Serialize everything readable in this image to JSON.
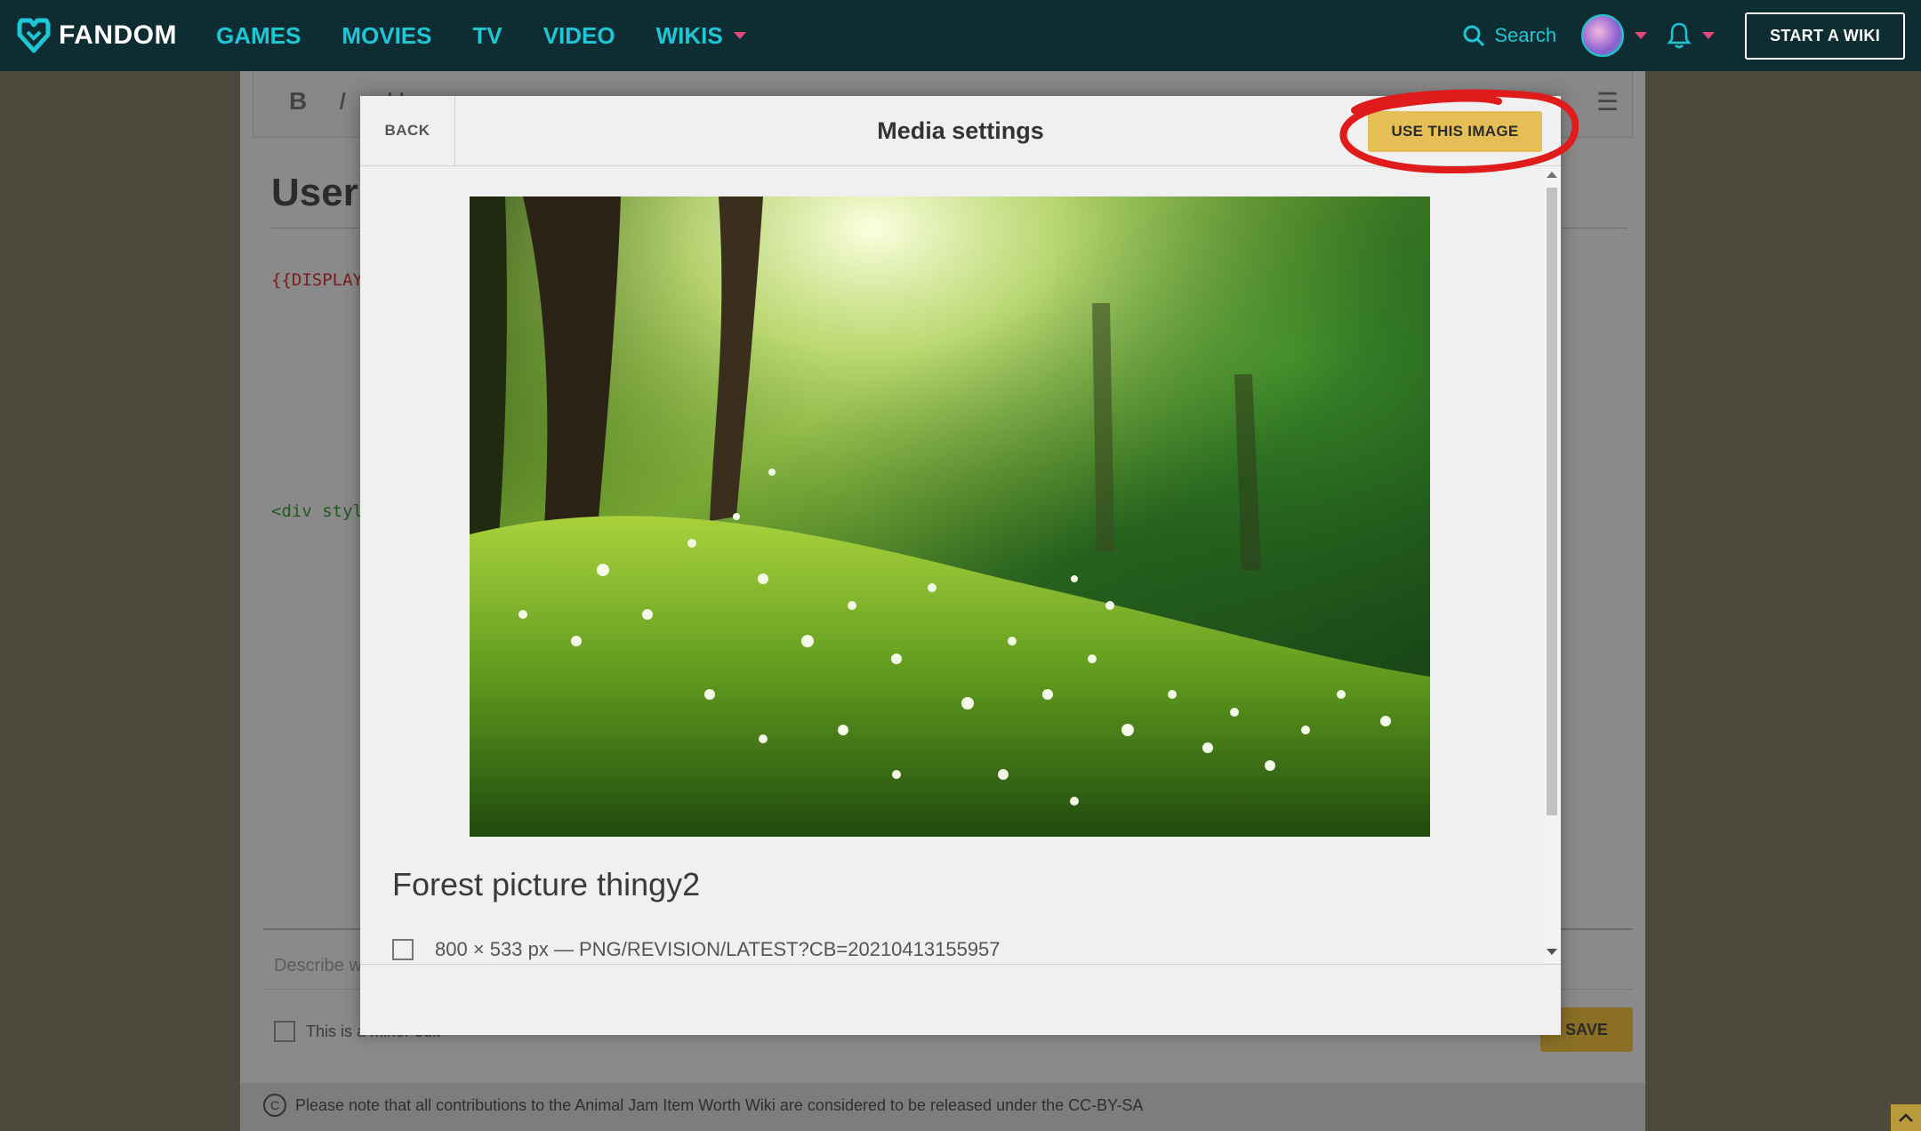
{
  "nav": {
    "brand": "FANDOM",
    "links": [
      "GAMES",
      "MOVIES",
      "TV",
      "VIDEO",
      "WIKIS"
    ],
    "search_label": "Search",
    "start_wiki": "START A WIKI",
    "accent": "#1ec7d6",
    "background": "#0d2d33"
  },
  "editor": {
    "toolbar_mode": "ADVANCED",
    "page_title": "User",
    "code_line_1": "{{DISPLAY",
    "code_line_2": "<div styl",
    "summary_placeholder": "Describe w",
    "minor_edit_label": "This is a minor edit",
    "save_label": "SAVE",
    "license_note": "Please note that all contributions to the Animal Jam Item Worth Wiki are considered to be released under the CC-BY-SA"
  },
  "modal": {
    "back_label": "BACK",
    "title": "Media settings",
    "use_image_label": "USE THIS IMAGE",
    "media_name": "Forest picture thingy2",
    "media_meta": "800 × 533 px — PNG/REVISION/LATEST?CB=20210413155957",
    "button_color": "#e5be55",
    "annotation_color": "#e01b1b"
  }
}
